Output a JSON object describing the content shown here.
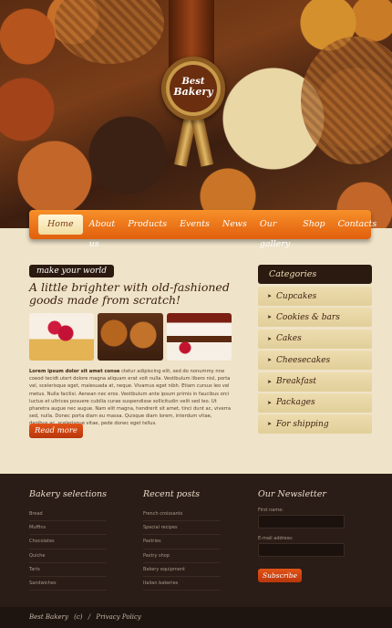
{
  "brand": {
    "badge_line1": "Best",
    "badge_line2": "Bakery"
  },
  "nav": {
    "items": [
      "Home",
      "About us",
      "Products",
      "Events",
      "News",
      "Our gallery",
      "Shop",
      "Contacts"
    ],
    "active": "Home"
  },
  "main": {
    "tag": "make your world",
    "headline": "A little brighter with old-fashioned goods made from scratch!",
    "body_lead": "Lorem ipsum dolor sit amet conse",
    "body_text": "ctetur adipiscing elit, sed do nonummy nne coeod tecidt.utert dolore magna aliquam erat volt nulla. Vestibulum libero nisl, porta vel, scelerisque eget, malesuada at, neque. Vivamus eget nibh. Etiam cursus leo vel metus. Nulla facilisi. Aenean nec eros. Vestibulum ante ipsum primis in faucibus orci luctus et ultrices posuere cubilia curae suspendisse sollicitudin velit sed leo. Ut pharetra augue nec augue. Nam elit magna, hendrerit sit amet, tinci dunt ac, viverra sed, nulla. Donec porta diam eu massa. Quisque diam lorem, interdum vitae, dapibus ac, scelerisque vitae, pede donec eget tellus.",
    "read_more": "Read more",
    "thumbs": [
      "strawberry-cheesecake",
      "muffins",
      "cream-cake"
    ]
  },
  "sidebar": {
    "title": "Categories",
    "items": [
      "Cupcakes",
      "Cookies & bars",
      "Cakes",
      "Cheesecakes",
      "Breakfast",
      "Packages",
      "For shipping"
    ]
  },
  "footer": {
    "selections": {
      "title": "Bakery selections",
      "items": [
        "Bread",
        "Muffins",
        "Chocolates",
        "Quiche",
        "Tarts",
        "Sandwiches"
      ]
    },
    "recent": {
      "title": "Recent posts",
      "items": [
        "French croissants",
        "Special recipes",
        "Pastries",
        "Pastry shop",
        "Bakery equipment",
        "Italian bakeries"
      ]
    },
    "newsletter": {
      "title": "Our Newsletter",
      "first_name_label": "First name:",
      "email_label": "E-mail address:",
      "subscribe": "Subscribe"
    },
    "bottom": {
      "brand": "Best Bakery",
      "copyright": "(c)",
      "separator": "/",
      "privacy": "Privacy Policy"
    }
  },
  "colors": {
    "accent": "#e8701a",
    "dark": "#2b1a10",
    "background": "#efe3c9",
    "footer": "#2a1c16"
  }
}
